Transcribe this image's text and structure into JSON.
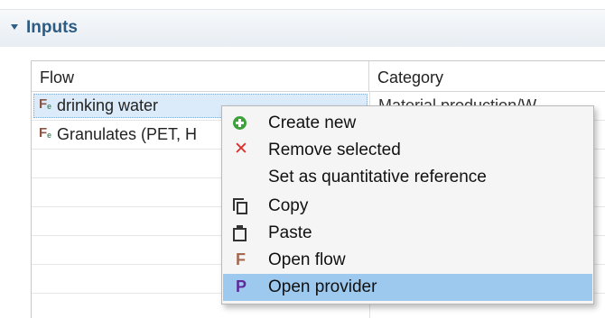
{
  "section": {
    "title": "Inputs"
  },
  "table": {
    "columns": [
      "Flow",
      "Category"
    ],
    "rows": [
      {
        "flow": "drinking water",
        "category": "Material production/W...",
        "selected": true
      },
      {
        "flow": "Granulates (PET, H",
        "category": "",
        "selected": false
      }
    ]
  },
  "context_menu": {
    "items": [
      {
        "label": "Create new",
        "icon": "add-circle-icon"
      },
      {
        "label": "Remove selected",
        "icon": "remove-x-icon"
      },
      {
        "label": "Set as quantitative reference",
        "icon": ""
      },
      {
        "label": "Copy",
        "icon": "copy-icon"
      },
      {
        "label": "Paste",
        "icon": "paste-icon"
      },
      {
        "label": "Open flow",
        "icon": "flow-f-icon"
      },
      {
        "label": "Open provider",
        "icon": "provider-p-icon",
        "highlighted": true
      }
    ]
  },
  "colors": {
    "section_title": "#2c5b83",
    "menu_highlight": "#9ec9ee",
    "selection": "#dcebf9",
    "create_icon": "#3ea23b",
    "remove_icon": "#d9302c",
    "flow_icon": "#a36a52",
    "provider_icon": "#5d2a9a"
  }
}
